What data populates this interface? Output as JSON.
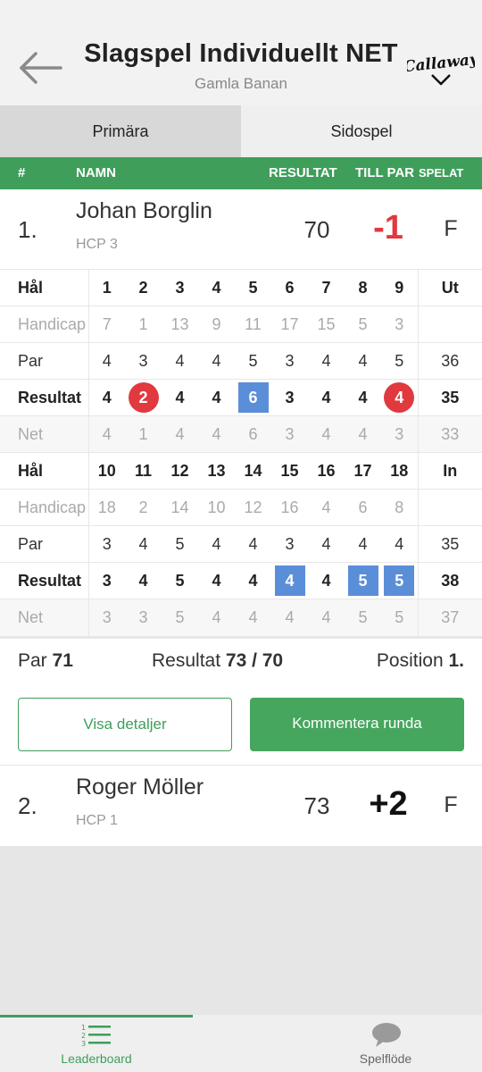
{
  "header": {
    "title": "Slagspel Individuellt NET",
    "subtitle": "Gamla Banan",
    "brand": "Callaway"
  },
  "tabs": [
    {
      "label": "Primära"
    },
    {
      "label": "Sidospel"
    }
  ],
  "columns": {
    "pos": "#",
    "name": "NAMN",
    "result": "RESULTAT",
    "to_par": "TILL PAR",
    "played": "SPELAT"
  },
  "players": [
    {
      "pos": "1.",
      "name": "Johan Borglin",
      "hcp": "HCP 3",
      "result": "70",
      "to_par": "-1",
      "played": "F"
    },
    {
      "pos": "2.",
      "name": "Roger Möller",
      "hcp": "HCP 1",
      "result": "73",
      "to_par": "+2",
      "played": "F"
    }
  ],
  "scorecard": {
    "labels": {
      "hole": "Hål",
      "handicap": "Handicap",
      "par": "Par",
      "result": "Resultat",
      "net": "Net"
    },
    "front": {
      "total_label": "Ut",
      "holes": [
        "1",
        "2",
        "3",
        "4",
        "5",
        "6",
        "7",
        "8",
        "9"
      ],
      "handicap": [
        "7",
        "1",
        "13",
        "9",
        "11",
        "17",
        "15",
        "5",
        "3"
      ],
      "par": [
        "4",
        "3",
        "4",
        "4",
        "5",
        "3",
        "4",
        "4",
        "5"
      ],
      "par_total": "36",
      "result": [
        "4",
        "2",
        "4",
        "4",
        "6",
        "3",
        "4",
        "4",
        "4"
      ],
      "result_total": "35",
      "net": [
        "4",
        "1",
        "4",
        "4",
        "6",
        "3",
        "4",
        "4",
        "3"
      ],
      "net_total": "33"
    },
    "back": {
      "total_label": "In",
      "holes": [
        "10",
        "11",
        "12",
        "13",
        "14",
        "15",
        "16",
        "17",
        "18"
      ],
      "handicap": [
        "18",
        "2",
        "14",
        "10",
        "12",
        "16",
        "4",
        "6",
        "8"
      ],
      "par": [
        "3",
        "4",
        "5",
        "4",
        "4",
        "3",
        "4",
        "4",
        "4"
      ],
      "par_total": "35",
      "result": [
        "3",
        "4",
        "5",
        "4",
        "4",
        "4",
        "4",
        "5",
        "5"
      ],
      "result_total": "38",
      "net": [
        "3",
        "3",
        "5",
        "4",
        "4",
        "4",
        "4",
        "5",
        "5"
      ],
      "net_total": "37"
    }
  },
  "summary": {
    "par_label": "Par",
    "par_value": "71",
    "result_label": "Resultat",
    "result_value": "73 / 70",
    "position_label": "Position",
    "position_value": "1."
  },
  "actions": {
    "details": "Visa detaljer",
    "comment": "Kommentera runda"
  },
  "bottom_nav": [
    {
      "label": "Leaderboard",
      "icon": "leaderboard-icon"
    },
    {
      "label": "Spelflöde",
      "icon": "chat-bubble-icon"
    }
  ],
  "colors": {
    "green": "#3f9e5a",
    "birdie": "#e0393e",
    "bogey": "#5b8ed8",
    "under_par": "#e0393e",
    "over_par": "#111111"
  }
}
